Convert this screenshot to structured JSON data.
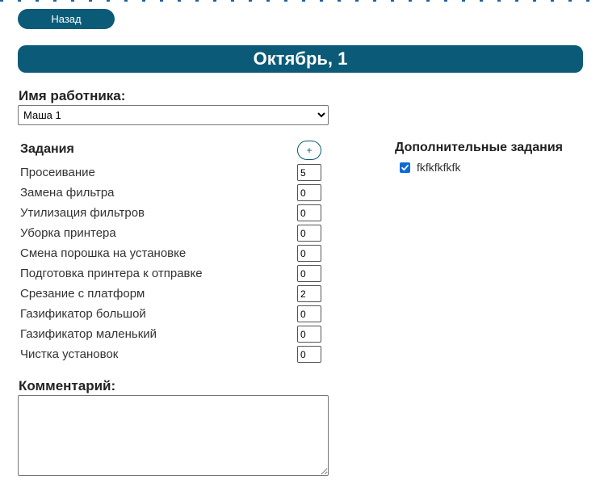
{
  "nav": {
    "back_label": "Назад"
  },
  "header": {
    "title": "Октябрь, 1"
  },
  "worker": {
    "label": "Имя работника:",
    "selected": "Маша 1"
  },
  "tasks": {
    "heading": "Задания",
    "add_label": "+",
    "items": [
      {
        "name": "Просеивание",
        "value": "5"
      },
      {
        "name": "Замена фильтра",
        "value": "0"
      },
      {
        "name": "Утилизация фильтров",
        "value": "0"
      },
      {
        "name": "Уборка принтера",
        "value": "0"
      },
      {
        "name": "Смена порошка на установке",
        "value": "0"
      },
      {
        "name": "Подготовка принтера к отправке",
        "value": "0"
      },
      {
        "name": "Срезание с платформ",
        "value": "2"
      },
      {
        "name": "Газификатор большой",
        "value": "0"
      },
      {
        "name": "Газификатор маленький",
        "value": "0"
      },
      {
        "name": "Чистка установок",
        "value": "0"
      }
    ]
  },
  "extra_tasks": {
    "heading": "Дополнительные задания",
    "items": [
      {
        "label": "fkfkfkfkfk",
        "checked": true
      }
    ]
  },
  "comment": {
    "label": "Комментарий:",
    "value": ""
  },
  "colors": {
    "accent": "#0b5b78",
    "checkbox": "#0b6bd6"
  }
}
